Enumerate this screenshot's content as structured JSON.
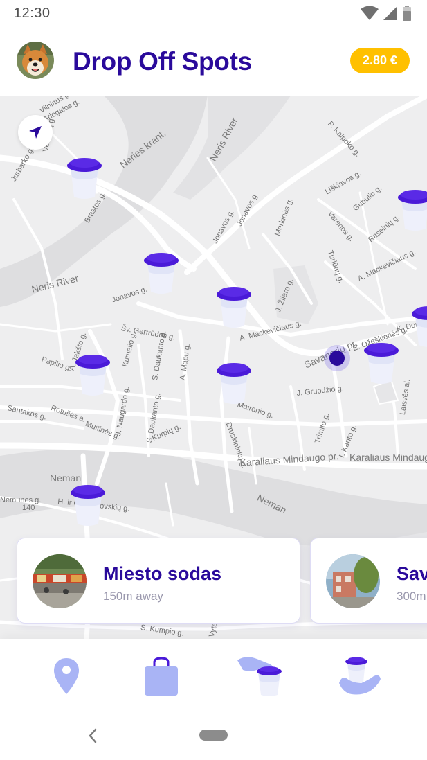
{
  "status_bar": {
    "time": "12:30"
  },
  "header": {
    "title": "Drop Off Spots",
    "balance": "2.80 €",
    "avatar_icon": "dog-avatar-icon"
  },
  "map": {
    "labels": {
      "vilniaus": "Vilniaus g.",
      "jurbarko": "Jurbarko g.",
      "brastos": "Brastos g.",
      "veiveriu": "Veiverių g.",
      "ariogalos": "Ariogalos g.",
      "neris_krant": "Neries krant.",
      "neris_river_1": "Neris River",
      "neris_river_2": "Neris River",
      "jonavos_1": "Jonavos g.",
      "jonavos_2": "Jonavos g.",
      "jonavos_3": "Jonavos g.",
      "p_kalpoko": "P. Kalpoko g.",
      "liskiavos": "Liškiavos g.",
      "gubulio": "Gubulio g.",
      "varenos": "Varėnos g.",
      "raseiniu": "Raseinių g.",
      "a_mackeviciaus_1": "A. Mackevičiaus g.",
      "a_mackeviciaus_2": "A. Mackevičiaus g.",
      "merkines": "Merkinės g.",
      "turiunu": "Turiūnų g.",
      "j_zilaro": "J. Žilaro g.",
      "sv_gertrudos": "Šv. Gertrūdos g.",
      "savanoriu": "Savanorių pr.",
      "e_ozeskienes": "E. Ožeškienės g.",
      "k_done": "K. Done",
      "a_jaksto": "A. Jakšto g.",
      "papilio": "Papilio g.",
      "kumelio": "Kumelio g.",
      "s_daukanto_1": "S. Daukanto g.",
      "s_daukanto_2": "S. Daukanto g.",
      "j_gruodzio": "J. Gruodžio g.",
      "santakos": "Santakos g.",
      "rotuses": "Rotušės a.",
      "muitines": "Muitinės g.",
      "j_naugardo": "J. Naugardo g.",
      "kurpiu": "Kurpių g.",
      "druskininku": "Druskininkų g.",
      "trimito": "Trimito g.",
      "i_kanto": "I. Kanto g.",
      "maironio": "Maironio g.",
      "laisves": "Laisvės al.",
      "karaliaus_1": "Karaliaus Mindaugo pr.",
      "karaliaus_2": "Karaliaus Mindaugo pr.",
      "neman_1": "Neman",
      "neman_2": "Neman",
      "nemunes": "Nemunes g.",
      "h_ir_o": "H. ir O. Minkovskių g.",
      "n140": "140",
      "a_mapu": "A. Mapu g.",
      "kumpio": "S. Kumpio g.",
      "vytauto": "Vytauto pr."
    }
  },
  "spots": [
    {
      "name": "Miesto sodas",
      "distance": "150m away"
    },
    {
      "name": "Sav",
      "distance": "300m"
    }
  ],
  "bottom_nav": [
    {
      "icon": "location-pin-icon"
    },
    {
      "icon": "shopping-bag-icon"
    },
    {
      "icon": "hand-cup-icon"
    },
    {
      "icon": "cup-return-icon"
    }
  ],
  "colors": {
    "brand": "#2a0a9b",
    "accent": "#ffc000",
    "cup_lid": "#4a1ad8",
    "cup_body": "#eef0fb",
    "nav_icon": "#a9b4f5"
  }
}
